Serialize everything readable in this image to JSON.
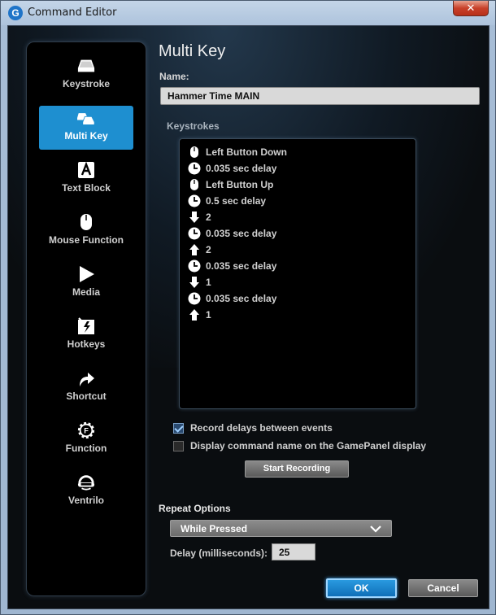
{
  "window": {
    "title": "Command Editor",
    "logo": "G",
    "close_label": "✕"
  },
  "sidebar": {
    "items": [
      {
        "label": "Keystroke",
        "icon": "key-icon",
        "active": false
      },
      {
        "label": "Multi Key",
        "icon": "multi-key-icon",
        "active": true
      },
      {
        "label": "Text Block",
        "icon": "text-block-icon",
        "active": false
      },
      {
        "label": "Mouse Function",
        "icon": "mouse-icon",
        "active": false
      },
      {
        "label": "Media",
        "icon": "play-icon",
        "active": false
      },
      {
        "label": "Hotkeys",
        "icon": "hotkey-icon",
        "active": false
      },
      {
        "label": "Shortcut",
        "icon": "shortcut-arrow-icon",
        "active": false
      },
      {
        "label": "Function",
        "icon": "function-gear-icon",
        "active": false
      },
      {
        "label": "Ventrilo",
        "icon": "headset-icon",
        "active": false
      }
    ]
  },
  "main": {
    "heading": "Multi Key",
    "name_label": "Name:",
    "name_value": "Hammer Time MAIN",
    "keystrokes_label": "Keystrokes",
    "keystrokes": [
      {
        "icon": "mouse-icon",
        "text": "Left Button Down"
      },
      {
        "icon": "clock-icon",
        "text": "0.035 sec delay"
      },
      {
        "icon": "mouse-icon",
        "text": "Left Button Up"
      },
      {
        "icon": "clock-icon",
        "text": "0.5 sec delay"
      },
      {
        "icon": "arrow-down-icon",
        "text": "2"
      },
      {
        "icon": "clock-icon",
        "text": "0.035 sec delay"
      },
      {
        "icon": "arrow-up-icon",
        "text": "2"
      },
      {
        "icon": "clock-icon",
        "text": "0.035 sec delay"
      },
      {
        "icon": "arrow-down-icon",
        "text": "1"
      },
      {
        "icon": "clock-icon",
        "text": "0.035 sec delay"
      },
      {
        "icon": "arrow-up-icon",
        "text": "1"
      }
    ],
    "record_delays": {
      "label": "Record delays between events",
      "checked": true
    },
    "display_name": {
      "label": "Display command name on the GamePanel display",
      "checked": false
    },
    "start_recording": "Start Recording"
  },
  "repeat": {
    "label": "Repeat Options",
    "selected": "While Pressed",
    "delay_label": "Delay (milliseconds):",
    "delay_value": "25"
  },
  "footer": {
    "ok": "OK",
    "cancel": "Cancel"
  },
  "colors": {
    "accent": "#1e8fd0",
    "background": "#000000",
    "text": "#d0d0d0"
  }
}
